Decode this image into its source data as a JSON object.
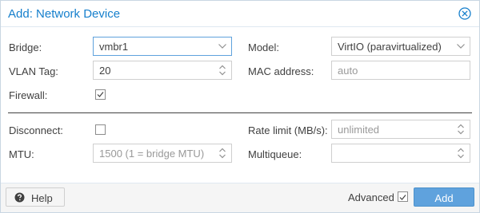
{
  "dialog": {
    "title": "Add: Network Device"
  },
  "left": {
    "bridge": {
      "label": "Bridge:",
      "value": "vmbr1"
    },
    "vlan_tag": {
      "label": "VLAN Tag:",
      "value": "20"
    },
    "firewall": {
      "label": "Firewall:",
      "checked": true
    }
  },
  "right": {
    "model": {
      "label": "Model:",
      "value": "VirtIO (paravirtualized)"
    },
    "mac": {
      "label": "MAC address:",
      "placeholder": "auto"
    }
  },
  "advanced": {
    "disconnect": {
      "label": "Disconnect:",
      "checked": false
    },
    "mtu": {
      "label": "MTU:",
      "placeholder": "1500 (1 = bridge MTU)"
    },
    "rate_limit": {
      "label": "Rate limit (MB/s):",
      "placeholder": "unlimited"
    },
    "multiqueue": {
      "label": "Multiqueue:",
      "value": ""
    }
  },
  "footer": {
    "help_label": "Help",
    "advanced_label": "Advanced",
    "advanced_checked": true,
    "add_label": "Add"
  },
  "colors": {
    "accent": "#157fcc",
    "primary_button": "#5fa2dd",
    "field_border": "#cfcfcf",
    "focus_border": "#5fa2dd"
  },
  "icons": {
    "close": "close-circle-icon",
    "dropdown": "chevron-down-icon",
    "spinner": "spinner-updown-icon",
    "help": "question-circle-icon",
    "check": "checkmark-icon"
  }
}
